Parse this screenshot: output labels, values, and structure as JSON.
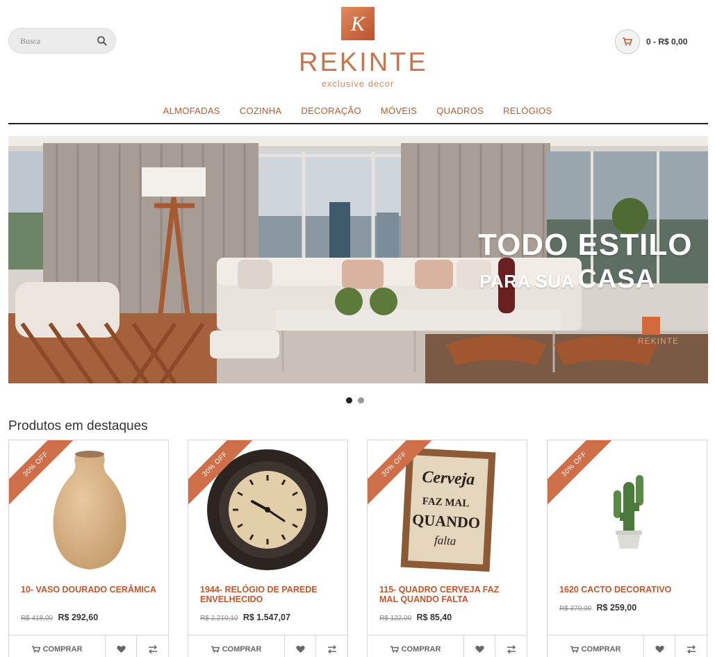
{
  "search": {
    "placeholder": "Busca"
  },
  "logo": {
    "mark_letter": "K",
    "word": "REKINTE",
    "tagline": "exclusive decor"
  },
  "cart": {
    "summary": "0 - R$ 0,00"
  },
  "nav": {
    "items": [
      {
        "label": "ALMOFADAS"
      },
      {
        "label": "COZINHA"
      },
      {
        "label": "DECORAÇÃO"
      },
      {
        "label": "MÓVEIS"
      },
      {
        "label": "QUADROS"
      },
      {
        "label": "RELÓGIOS"
      }
    ]
  },
  "banner": {
    "line1": "TODO ESTILO",
    "line2_small": "PARA SUA",
    "line2_big": "CASA",
    "watermark": "REKINTE"
  },
  "carousel": {
    "slides": 2,
    "active": 0
  },
  "section": {
    "title": "Produtos em destaques"
  },
  "products": [
    {
      "badge": "30% OFF",
      "name": "10- VASO DOURADO CERÂMICA",
      "old_price": "R$ 418,00",
      "price": "R$ 292,60",
      "buy_label": "COMPRAR",
      "icon": "vase"
    },
    {
      "badge": "30% OFF",
      "name": "1944- RELÓGIO DE PAREDE ENVELHECIDO",
      "old_price": "R$ 2.210,10",
      "price": "R$ 1.547,07",
      "buy_label": "COMPRAR",
      "icon": "clock"
    },
    {
      "badge": "30% OFF",
      "name": "115- QUADRO CERVEJA FAZ MAL QUANDO FALTA",
      "old_price": "R$ 122,00",
      "price": "R$ 85,40",
      "buy_label": "COMPRAR",
      "icon": "frame",
      "frame_text": [
        "Cerveja",
        "FAZ MAL",
        "QUANDO",
        "falta"
      ]
    },
    {
      "badge": "30% OFF",
      "name": "1620 CACTO DECORATIVO",
      "old_price": "R$ 370,00",
      "price": "R$ 259,00",
      "buy_label": "COMPRAR",
      "icon": "cactus"
    }
  ],
  "colors": {
    "brand": "#c8754d",
    "nav_text": "#b5592c",
    "badge": "#cf6f49",
    "product_name": "#c0562c"
  }
}
